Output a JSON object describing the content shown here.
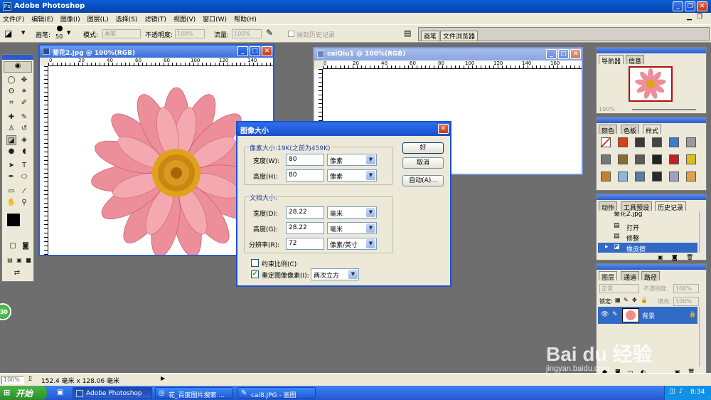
{
  "app": {
    "title": "Adobe Photoshop"
  },
  "menubar": {
    "items": [
      "文件(F)",
      "编辑(E)",
      "图像(I)",
      "图层(L)",
      "选择(S)",
      "滤镜(T)",
      "视图(V)",
      "窗口(W)",
      "帮助(H)"
    ]
  },
  "options": {
    "brush_label": "画笔:",
    "brush_size": "50",
    "mode_label": "模式:",
    "mode_value": "画笔",
    "opacity_label": "不透明度:",
    "opacity_value": "100%",
    "flow_label": "流量:",
    "flow_value": "100%",
    "erase_history_label": "抹到历史记录",
    "palette_tabs": [
      "画笔",
      "文件浏览器"
    ]
  },
  "doc1": {
    "title": "菊花2.jpg @ 100%(RGB)",
    "ruler_ticks": [
      "0",
      "20",
      "40",
      "60",
      "80",
      "100",
      "120",
      "140"
    ]
  },
  "doc2": {
    "title": "caiQiu1 @ 100%(RGB)",
    "ruler_ticks": [
      "0",
      "20",
      "40",
      "60",
      "80",
      "100",
      "120",
      "140",
      "160"
    ]
  },
  "dialog": {
    "title": "图像大小",
    "pixel_group": "像素大小:19K(之前为459K)",
    "width_label": "宽度(W):",
    "width_value": "80",
    "width_unit": "像素",
    "height_label": "高度(H):",
    "height_value": "80",
    "height_unit": "像素",
    "doc_group": "文档大小:",
    "doc_width_label": "宽度(D):",
    "doc_width_value": "28.22",
    "doc_width_unit": "毫米",
    "doc_height_label": "高度(G):",
    "doc_height_value": "28.22",
    "doc_height_unit": "毫米",
    "resolution_label": "分辨率(R):",
    "resolution_value": "72",
    "resolution_unit": "像素/英寸",
    "constrain_label": "约束比例(C)",
    "constrain_checked": false,
    "resample_label": "重定图像像素(I):",
    "resample_checked": true,
    "resample_value": "两次立方",
    "ok_label": "好",
    "cancel_label": "取消",
    "auto_label": "自动(A)..."
  },
  "navigator": {
    "tabs": [
      "导航器",
      "信息"
    ],
    "zoom": "100%"
  },
  "swatches": {
    "tabs": [
      "颜色",
      "色板",
      "样式"
    ]
  },
  "history": {
    "tabs": [
      "动作",
      "工具预设",
      "历史记录"
    ],
    "snapshot": "菊花2.jpg",
    "items": [
      "打开",
      "修整",
      "橡皮擦"
    ]
  },
  "layers": {
    "tabs": [
      "图层",
      "通道",
      "路径"
    ],
    "blend": "正常",
    "opacity_label": "不透明度:",
    "opacity": "100%",
    "lock_label": "锁定:",
    "fill_label": "填充:",
    "fill": "100%",
    "layer_name": "背景"
  },
  "status": {
    "zoom": "100%",
    "info": "152.4 毫米 x 128.06 毫米"
  },
  "taskbar": {
    "start": "开始",
    "tasks": [
      "Adobe Photoshop",
      "花_百度图片搜索 ...",
      "cai8.JPG - 画图"
    ],
    "time": "8:34"
  },
  "watermark": {
    "brand": "Bai du 经验",
    "url": "jingyan.baidu.com"
  },
  "badge": "30",
  "colors": {
    "xp_blue": "#0a5fd8",
    "dialog_face": "#ece9d8",
    "workspace": "#6e6e6e",
    "flower_pink": "#e8808c",
    "flower_center": "#e0a21a"
  }
}
